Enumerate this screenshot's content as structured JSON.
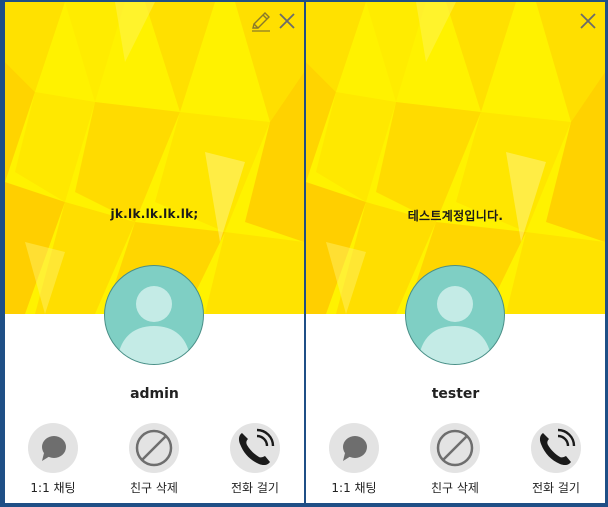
{
  "cards": [
    {
      "status_message": "jk.lk.lk.lk.lk;",
      "username": "admin",
      "has_edit": true
    },
    {
      "status_message": "테스트계정입니다.",
      "username": "tester",
      "has_edit": false
    }
  ],
  "actions": {
    "chat_label": "1:1 채팅",
    "delete_label": "친구 삭제",
    "call_label": "전화 걸기"
  },
  "icons": {
    "close": "close-icon",
    "edit": "pencil-icon",
    "chat": "speech-bubble-icon",
    "delete": "prohibited-icon",
    "call": "phone-icon",
    "avatar": "person-silhouette-icon"
  },
  "colors": {
    "banner_yellow": "#fff200",
    "avatar_teal": "#7fcfc4",
    "background_blue": "#1f4f86"
  }
}
